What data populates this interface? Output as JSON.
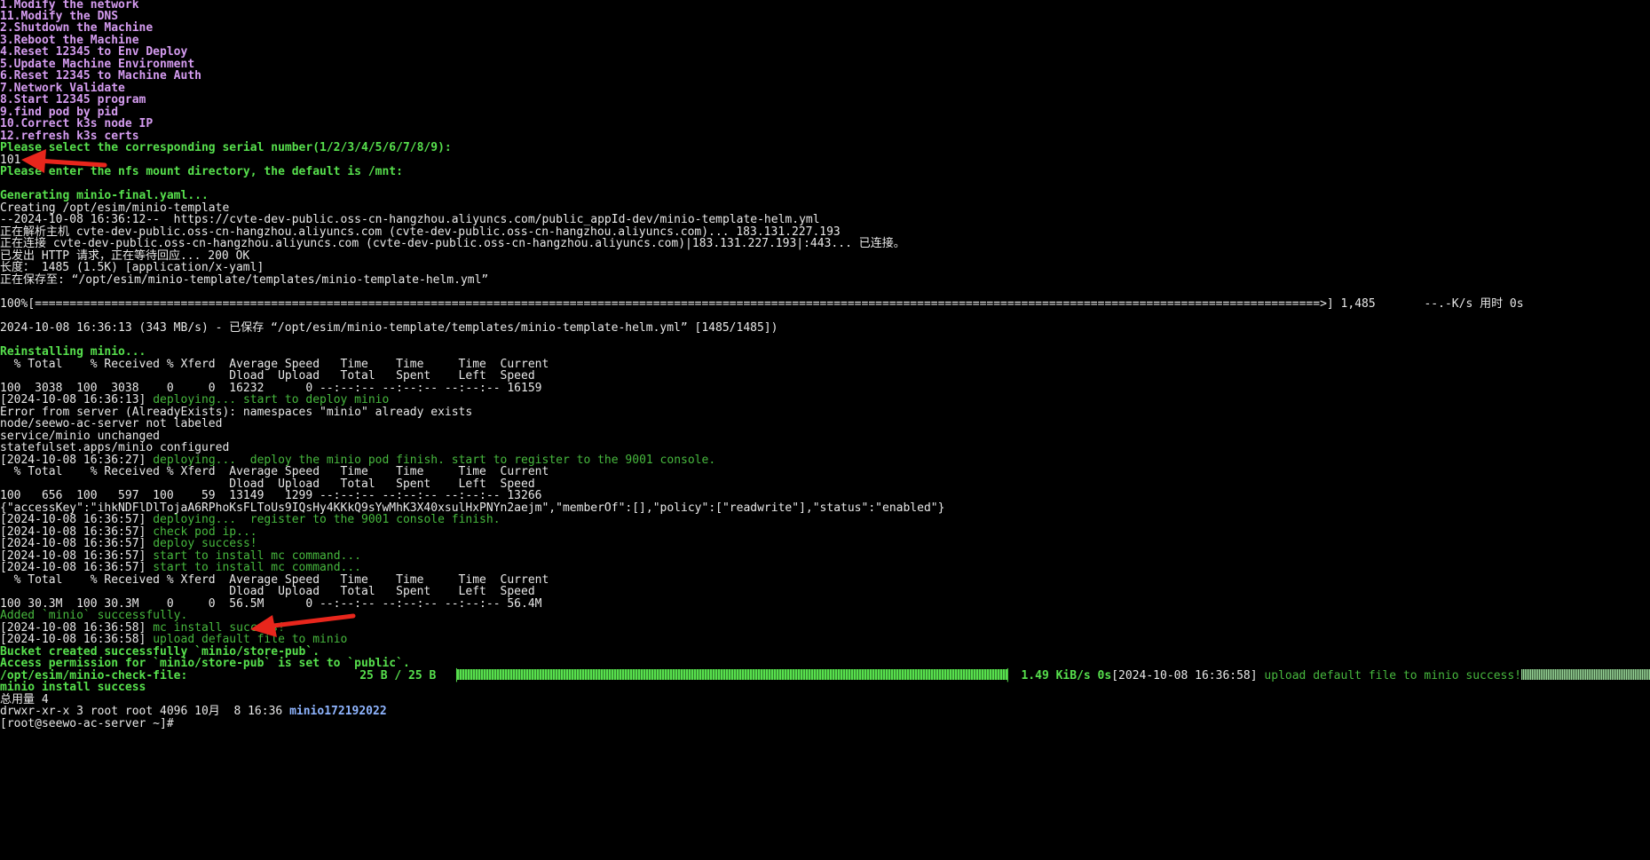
{
  "menu": [
    "1.Modify the network",
    "11.Modify the DNS",
    "2.Shutdown the Machine",
    "3.Reboot the Machine",
    "4.Reset 12345 to Env Deploy",
    "5.Update Machine Environment",
    "6.Reset 12345 to Machine Auth",
    "7.Network Validate",
    "8.Start 12345 program",
    "9.find pod by pid",
    "10.Correct k3s node IP",
    "12.refresh k3s certs"
  ],
  "prompt_select": "Please select the corresponding serial number(1/2/3/4/5/6/7/8/9):",
  "user_input": "101",
  "prompt_nfs": "Please enter the nfs mount directory, the default is /mnt:",
  "generating": "Generating minio-final.yaml...",
  "creating": "Creating /opt/esim/minio-template",
  "wget": [
    "--2024-10-08 16:36:12--  https://cvte-dev-public.oss-cn-hangzhou.aliyuncs.com/public_appId-dev/minio-template-helm.yml",
    "正在解析主机 cvte-dev-public.oss-cn-hangzhou.aliyuncs.com (cvte-dev-public.oss-cn-hangzhou.aliyuncs.com)... 183.131.227.193",
    "正在连接 cvte-dev-public.oss-cn-hangzhou.aliyuncs.com (cvte-dev-public.oss-cn-hangzhou.aliyuncs.com)|183.131.227.193|:443... 已连接。",
    "已发出 HTTP 请求，正在等待回应... 200 OK",
    "长度： 1485 (1.5K) [application/x-yaml]",
    "正在保存至: “/opt/esim/minio-template/templates/minio-template-helm.yml”"
  ],
  "wget_progress": {
    "percent": "100%",
    "tail": "] 1,485       --.-K/s 用时 0s"
  },
  "saved": "2024-10-08 16:36:13 (343 MB/s) - 已保存 “/opt/esim/minio-template/templates/minio-template-helm.yml” [1485/1485])",
  "reinstalling": "Reinstalling minio...",
  "curl_header_1": "  % Total    % Received % Xferd  Average Speed   Time    Time     Time  Current",
  "curl_header_2": "                                 Dload  Upload   Total   Spent    Left  Speed",
  "curl_row_1": "100  3038  100  3038    0     0  16232      0 --:--:-- --:--:-- --:--:-- 16159",
  "log1": {
    "ts": "[2024-10-08 16:36:13]",
    "msg": " deploying... start to deploy minio"
  },
  "out_1": [
    "Error from server (AlreadyExists): namespaces \"minio\" already exists",
    "node/seewo-ac-server not labeled",
    "service/minio unchanged",
    "statefulset.apps/minio configured"
  ],
  "log2": {
    "ts": "[2024-10-08 16:36:27]",
    "msg": " deploying...  deploy the minio pod finish. start to register to the 9001 console."
  },
  "curl_row_2": "100   656  100   597  100    59  13149   1299 --:--:-- --:--:-- --:--:-- 13266",
  "json_line": "{\"accessKey\":\"ihkNDFlDlTojaA6RPhoKsFLToUs9IQsHy4KKkQ9sYwMhK3X40xsulHxPNYn2aejm\",\"memberOf\":[],\"policy\":[\"readwrite\"],\"status\":\"enabled\"}",
  "log3": [
    {
      "ts": "[2024-10-08 16:36:57]",
      "msg": " deploying...  register to the 9001 console finish."
    },
    {
      "ts": "[2024-10-08 16:36:57]",
      "msg": " check pod ip..."
    },
    {
      "ts": "[2024-10-08 16:36:57]",
      "msg": " deploy success!"
    },
    {
      "ts": "[2024-10-08 16:36:57]",
      "msg": " start to install mc command..."
    },
    {
      "ts": "[2024-10-08 16:36:57]",
      "msg": " start to install mc command..."
    }
  ],
  "curl_row_3": "100 30.3M  100 30.3M    0     0  56.5M      0 --:--:-- --:--:-- --:--:-- 56.4M",
  "added": "Added `minio` successfully.",
  "log4": [
    {
      "ts": "[2024-10-08 16:36:58]",
      "msg": " mc install success!"
    },
    {
      "ts": "[2024-10-08 16:36:58]",
      "msg": " upload default file to minio"
    }
  ],
  "bucket": "Bucket created successfully `minio/store-pub`.",
  "access": "Access permission for `minio/store-pub` is set to `public`.",
  "upload": {
    "path": "/opt/esim/minio-check-file:",
    "size": "25 B / 25 B",
    "rate": " 1.49 KiB/s 0s",
    "ts": "[2024-10-08 16:36:58]",
    "msg": " upload default file to minio success!"
  },
  "install_success": "minio install success",
  "total": "总用量 4",
  "ls_prefix": "drwxr-xr-x 3 root root 4096 10月  8 16:36 ",
  "ls_name": "minio172192022",
  "prompt_last": "[root@seewo-ac-server ~]#",
  "colors": {
    "background": "#000000",
    "menu": "#d59cf0",
    "green_bold": "#57e04d",
    "green": "#47b83e",
    "text": "#e8e8e8",
    "dir": "#8fb5ff",
    "annotation": "#e8261c"
  }
}
